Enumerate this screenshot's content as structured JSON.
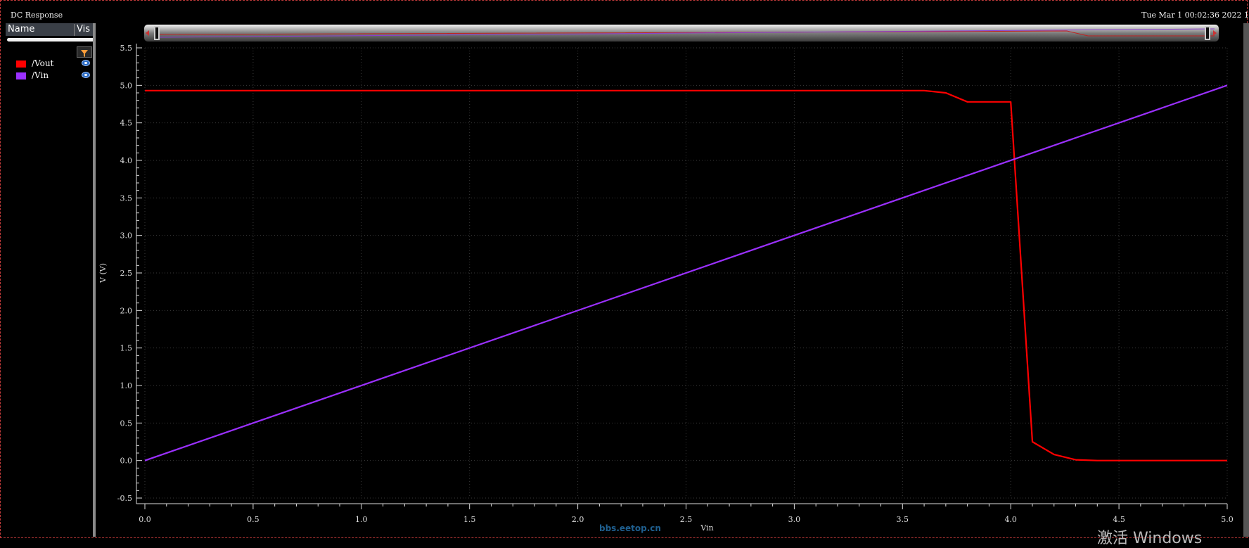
{
  "window": {
    "title": "DC Response",
    "date": "Tue Mar  1 00:02:36 2022  1"
  },
  "panel": {
    "col_name": "Name",
    "col_vis": "Vis",
    "items": [
      {
        "name": "/Vout",
        "color": "#ff0000"
      },
      {
        "name": "/Vin",
        "color": "#9b30ff"
      }
    ]
  },
  "watermark": "bbs.eetop.cn",
  "activate_text": "激活 Windows",
  "chart_data": {
    "type": "line",
    "xlabel": "Vin",
    "ylabel": "V (V)",
    "xlim": [
      0.0,
      5.0
    ],
    "ylim": [
      -0.5,
      5.5
    ],
    "xticks": [
      "0.0",
      "0.5",
      "1.0",
      "1.5",
      "2.0",
      "2.5",
      "3.0",
      "3.5",
      "4.0",
      "4.5",
      "5.0"
    ],
    "yticks": [
      "-0.5",
      "0.0",
      "0.5",
      "1.0",
      "1.5",
      "2.0",
      "2.5",
      "3.0",
      "3.5",
      "4.0",
      "4.5",
      "5.0",
      "5.5"
    ],
    "xminor_step": 0.1,
    "yminor_step": 0.1,
    "grid": true,
    "legend": "left-panel",
    "background": "#000000",
    "series": [
      {
        "name": "/Vout",
        "color": "#ff0000",
        "x": [
          0.0,
          3.6,
          3.7,
          3.8,
          3.9,
          4.0,
          4.1,
          4.2,
          4.3,
          4.4,
          5.0
        ],
        "y": [
          4.93,
          4.93,
          4.9,
          4.78,
          4.78,
          4.78,
          0.25,
          0.08,
          0.01,
          0.0,
          0.0
        ]
      },
      {
        "name": "/Vin",
        "color": "#9b30ff",
        "x": [
          0.0,
          5.0
        ],
        "y": [
          0.0,
          5.0
        ]
      }
    ]
  }
}
